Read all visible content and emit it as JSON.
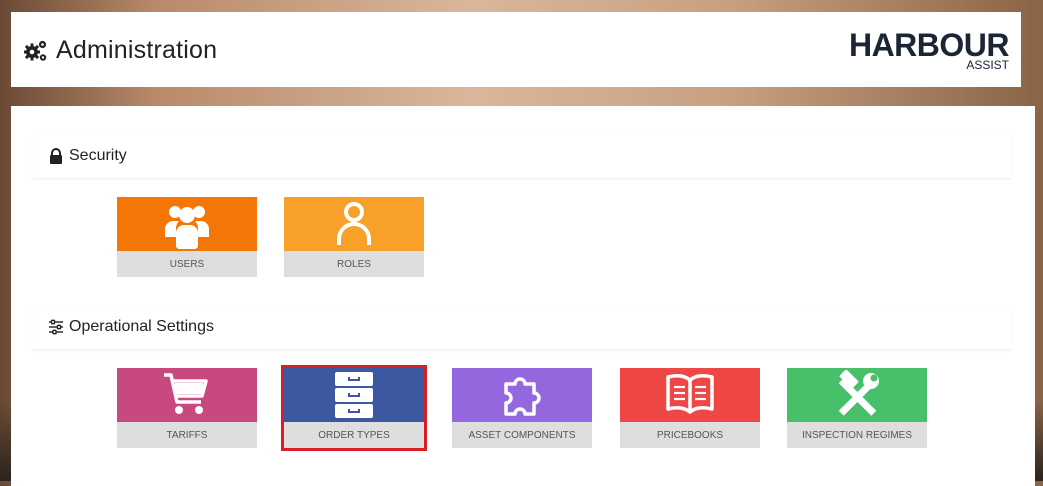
{
  "header": {
    "title": "Administration",
    "logo_brand": "HARBOUR",
    "logo_sub": "ASSIST"
  },
  "sections": [
    {
      "title": "Security",
      "icon": "lock-icon",
      "tiles": [
        {
          "label": "USERS",
          "icon": "users-icon",
          "color": "#f47607"
        },
        {
          "label": "ROLES",
          "icon": "user-icon",
          "color": "#f7a12a"
        }
      ]
    },
    {
      "title": "Operational Settings",
      "icon": "sliders-icon",
      "tiles": [
        {
          "label": "TARIFFS",
          "icon": "cart-icon",
          "color": "#c8497f"
        },
        {
          "label": "ORDER TYPES",
          "icon": "file-cabinet-icon",
          "color": "#3c58a0",
          "selected": true
        },
        {
          "label": "ASSET COMPONENTS",
          "icon": "puzzle-icon",
          "color": "#9467de"
        },
        {
          "label": "PRICEBOOKS",
          "icon": "book-icon",
          "color": "#ef4646"
        },
        {
          "label": "INSPECTION REGIMES",
          "icon": "tools-icon",
          "color": "#48c06a"
        }
      ]
    }
  ]
}
